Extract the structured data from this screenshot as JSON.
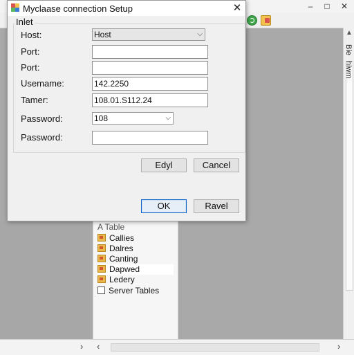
{
  "app": {
    "window_controls": {
      "minimize": "–",
      "maximize": "□",
      "close": "✕"
    },
    "toolbar_icons": [
      "refresh-icon",
      "database-icon"
    ],
    "side_labels": [
      "Bie",
      "hiwm"
    ]
  },
  "tree": {
    "header": "A Table",
    "items": [
      {
        "label": "Callies",
        "icon": "folder-icon",
        "selected": false
      },
      {
        "label": "Dalres",
        "icon": "folder-icon",
        "selected": false
      },
      {
        "label": "Canting",
        "icon": "folder-icon",
        "selected": false
      },
      {
        "label": "Dapwed",
        "icon": "folder-icon",
        "selected": true
      },
      {
        "label": "Ledery",
        "icon": "folder-icon",
        "selected": false
      },
      {
        "label": "Server Tables",
        "icon": "checkbox",
        "selected": false
      }
    ]
  },
  "scrollbar": {
    "left_arrow": "‹",
    "right_arrow": "›",
    "up_arrow": "▲"
  },
  "dialog": {
    "title": "Myclaase connection Setup",
    "close": "✕",
    "group_label": "Inlet",
    "fields": {
      "host": {
        "label": "Host:",
        "value": "Host",
        "type": "combo"
      },
      "port1": {
        "label": "Port:",
        "value": "",
        "type": "text"
      },
      "port2": {
        "label": "Port:",
        "value": "",
        "type": "text"
      },
      "username": {
        "label": "Usemame:",
        "value": "142.2250",
        "type": "text"
      },
      "tamer": {
        "label": "Tamer:",
        "value": "108.01.S112.24",
        "type": "text"
      },
      "password1": {
        "label": "Password:",
        "value": "108",
        "type": "combo"
      },
      "password2": {
        "label": "Password:",
        "value": "",
        "type": "text"
      }
    },
    "buttons": {
      "edyl": "Edyl",
      "cancel": "Cancel",
      "ok": "OK",
      "ravel": "Ravel"
    }
  }
}
